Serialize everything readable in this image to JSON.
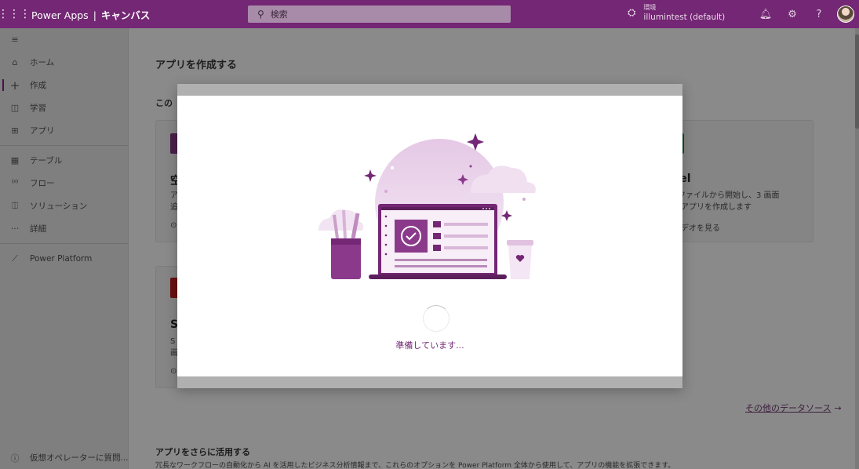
{
  "topbar": {
    "app_name": "Power Apps",
    "separator": "|",
    "mode": "キャンバス",
    "search_placeholder": "検索",
    "env_label": "環境",
    "env_name": "illumintest (default)"
  },
  "sidebar": {
    "items": [
      {
        "label": "ホーム",
        "icon": "home-icon"
      },
      {
        "label": "作成",
        "icon": "plus-icon"
      },
      {
        "label": "学習",
        "icon": "book-icon"
      },
      {
        "label": "アプリ",
        "icon": "apps-icon"
      },
      {
        "label": "テーブル",
        "icon": "table-icon"
      },
      {
        "label": "フロー",
        "icon": "flow-icon"
      },
      {
        "label": "ソリューション",
        "icon": "solution-icon"
      },
      {
        "label": "詳細",
        "icon": "more-icon"
      },
      {
        "label": "Power Platform",
        "icon": "power-platform-icon"
      }
    ],
    "bottom_label": "仮想オペレーターに質問..."
  },
  "main": {
    "create_heading": "アプリを作成する",
    "start_heading": "この",
    "card_blank": {
      "title": "空",
      "desc": "ア\n追",
      "video": "⊙"
    },
    "card_excel": {
      "title": "cel",
      "desc": "l ファイルから開始し、3 画面\nのアプリを作成します",
      "video": "ビデオを見る"
    },
    "card_sql": {
      "title": "S",
      "desc": "S\n画",
      "video": "⊙"
    },
    "more_sources": "その他のデータソース",
    "advance_heading": "アプリをさらに活用する",
    "advance_desc": "冗長なワークフローの自動化から AI を活用したビジネス分析情報まで、これらのオプションを Power Platform 全体から使用して、アプリの機能を拡張できます。"
  },
  "modal": {
    "loading_text": "準備しています..."
  },
  "colors": {
    "brand": "#742774",
    "overlay": "#8a8a8a"
  }
}
